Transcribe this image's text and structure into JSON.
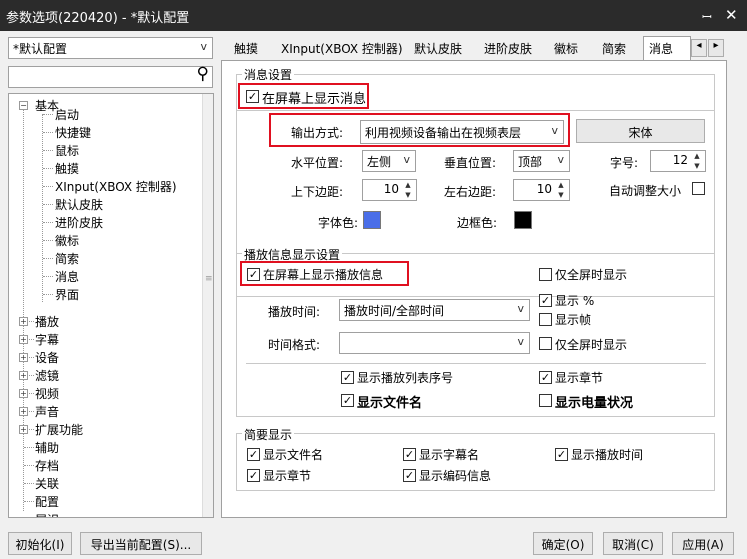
{
  "window": {
    "title": "参数选项(220420) - *默认配置",
    "pin_glyph": "ꟷ",
    "close_glyph": "✕"
  },
  "profile": {
    "value": "*默认配置",
    "arrow": "v"
  },
  "search": {
    "value": "",
    "icon_glyph": "⚲"
  },
  "tree": {
    "basic": "基本",
    "children": [
      "启动",
      "快捷键",
      "鼠标",
      "触摸",
      "XInput(XBOX 控制器)",
      "默认皮肤",
      "进阶皮肤",
      "徽标",
      "简索",
      "消息",
      "界面"
    ],
    "top": [
      "播放",
      "字幕",
      "设备",
      "滤镜",
      "视频",
      "声音",
      "扩展功能",
      "辅助",
      "存档",
      "关联",
      "配置",
      "展识"
    ],
    "expander_minus": "−",
    "expander_plus": "+"
  },
  "tabs": [
    "触摸",
    "XInput(XBOX 控制器)",
    "默认皮肤",
    "进阶皮肤",
    "徽标",
    "简索",
    "消息"
  ],
  "tab_scroll": {
    "left": "◂",
    "right": "▸"
  },
  "msg_settings": {
    "title": "消息设置",
    "show_on_screen": "在屏幕上显示消息",
    "output_label": "输出方式:",
    "output_value": "利用视频设备输出在视频表层",
    "font_button": "宋体",
    "h_pos_label": "水平位置:",
    "h_pos_value": "左侧",
    "v_pos_label": "垂直位置:",
    "v_pos_value": "顶部",
    "size_label": "字号:",
    "size_value": "12",
    "tb_margin_label": "上下边距:",
    "tb_margin_value": "10",
    "lr_margin_label": "左右边距:",
    "lr_margin_value": "10",
    "auto_size_label": "自动调整大小",
    "font_color_label": "字体色:",
    "font_color": "#4a6ee8",
    "border_color_label": "边框色:",
    "border_color": "#000000"
  },
  "play_info": {
    "title": "播放信息显示设置",
    "show_play_info": "在屏幕上显示播放信息",
    "fullscreen_only_1": "仅全屏时显示",
    "play_time_label": "播放时间:",
    "play_time_value": "播放时间/全部时间",
    "show_percent": "显示 %",
    "show_frame": "显示帧",
    "time_format_label": "时间格式:",
    "time_format_value": "",
    "fullscreen_only_2": "仅全屏时显示",
    "show_playlist_no": "显示播放列表序号",
    "show_chapter": "显示章节",
    "show_filename": "显示文件名",
    "show_battery": "显示电量状况"
  },
  "brief": {
    "title": "简要显示",
    "show_filename": "显示文件名",
    "show_subtitle_name": "显示字幕名",
    "show_play_time": "显示播放时间",
    "show_chapter": "显示章节",
    "show_codec": "显示编码信息"
  },
  "checks": {
    "checked": "✓",
    "unchecked": ""
  },
  "footer": {
    "init": "初始化(I)",
    "export": "导出当前配置(S)...",
    "ok": "确定(O)",
    "cancel": "取消(C)",
    "apply": "应用(A)"
  }
}
